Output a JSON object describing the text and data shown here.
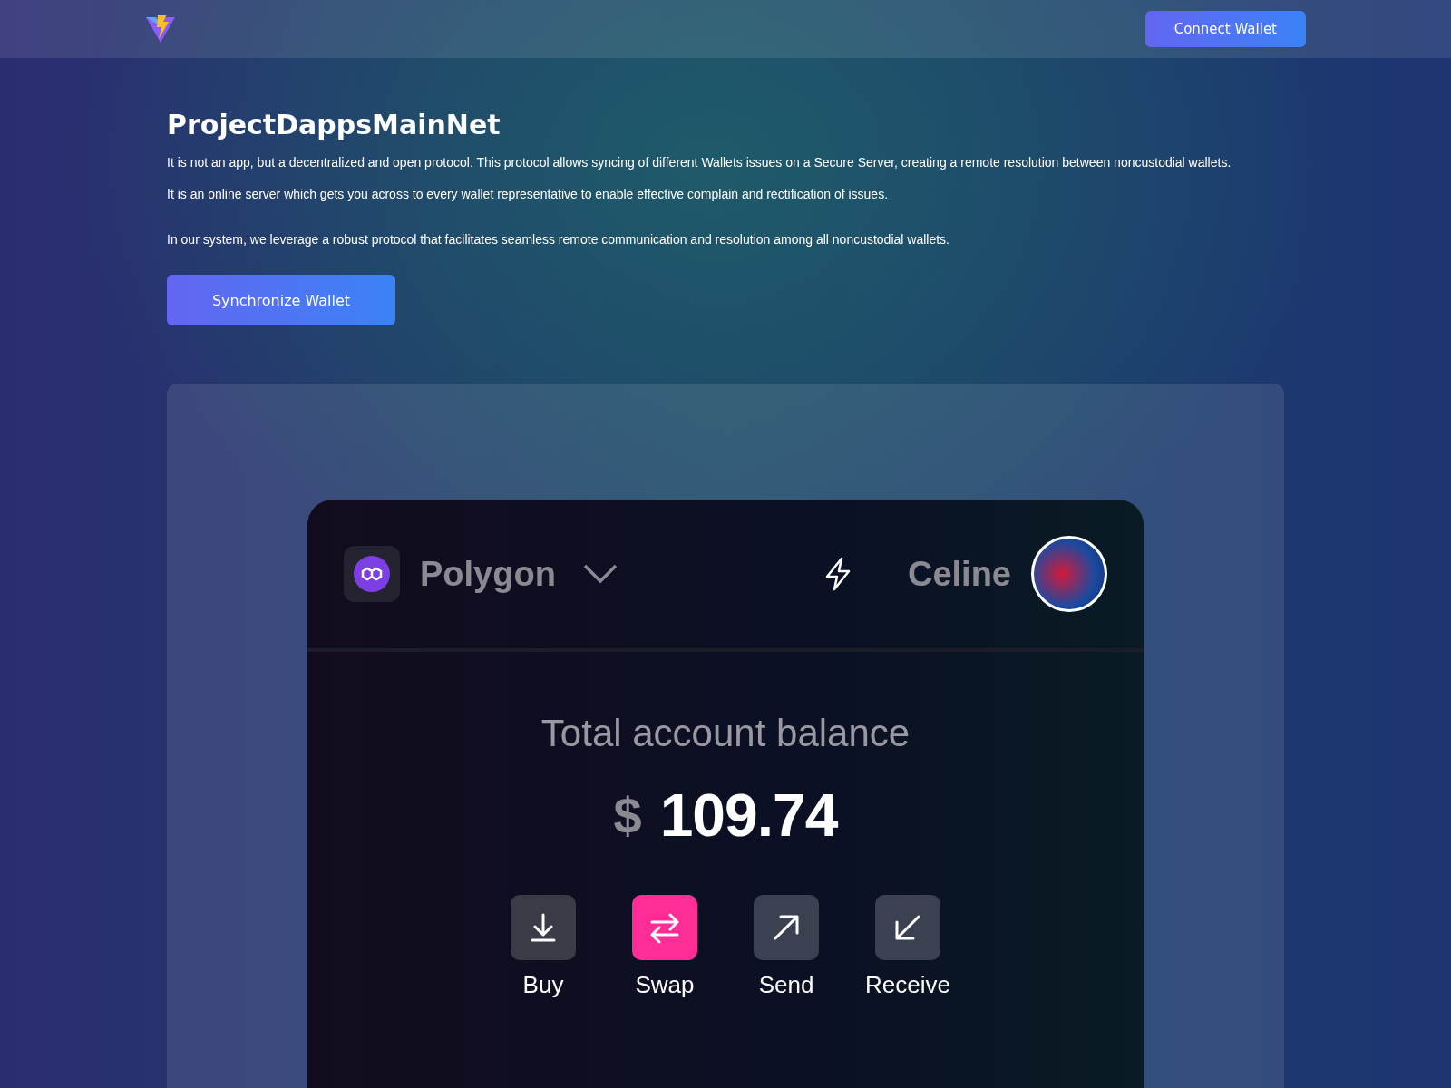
{
  "header": {
    "connect_button": "Connect Wallet"
  },
  "intro": {
    "title": "ProjectDappsMainNet",
    "paragraphs": [
      "It is not an app, but a decentralized and open protocol. This protocol allows syncing of different Wallets issues on a Secure Server, creating a remote resolution between noncustodial wallets.",
      "It is an online server which gets you across to every wallet representative to enable effective complain and rectification of issues.",
      "In our system, we leverage a robust protocol that facilitates seamless remote communication and resolution among all noncustodial wallets."
    ],
    "button": "Synchronize Wallet"
  },
  "wallet": {
    "network": "Polygon",
    "user": "Celine",
    "balance_label": "Total account balance",
    "currency": "$",
    "balance": "109.74",
    "actions": [
      {
        "kind": "buy",
        "label": "Buy",
        "selected": false
      },
      {
        "kind": "swap",
        "label": "Swap",
        "selected": true
      },
      {
        "kind": "send",
        "label": "Send",
        "selected": false
      },
      {
        "kind": "receive",
        "label": "Receive",
        "selected": false
      }
    ]
  }
}
